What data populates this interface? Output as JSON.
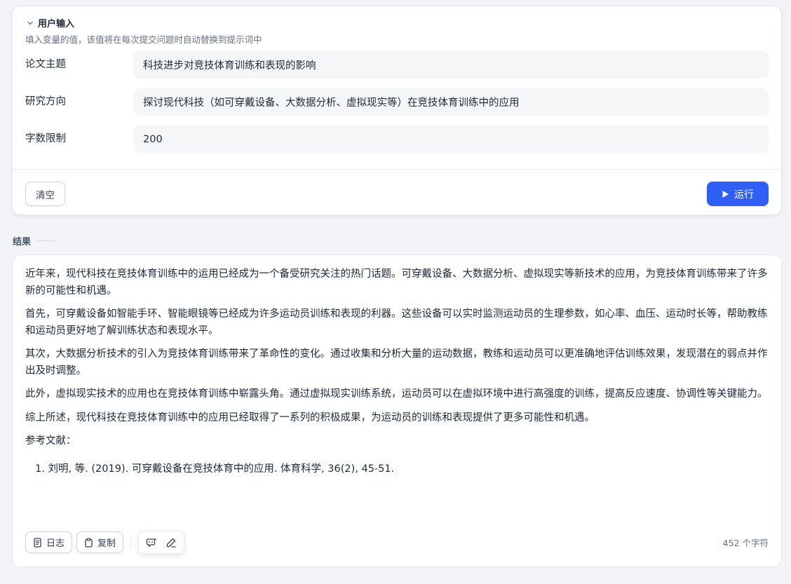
{
  "user_input": {
    "section_title": "用户输入",
    "description": "填入变量的值，该值将在每次提交问题时自动替换到提示词中",
    "fields": [
      {
        "label": "论文主题",
        "value": "科技进步对竞技体育训练和表现的影响"
      },
      {
        "label": "研究方向",
        "value": "探讨现代科技（如可穿戴设备、大数据分析、虚拟现实等）在竞技体育训练中的应用"
      },
      {
        "label": "字数限制",
        "value": "200"
      }
    ],
    "clear_label": "清空",
    "run_label": "运行"
  },
  "result": {
    "title": "结果",
    "paragraphs": [
      "近年来，现代科技在竞技体育训练中的运用已经成为一个备受研究关注的热门话题。可穿戴设备、大数据分析、虚拟现实等新技术的应用，为竞技体育训练带来了许多新的可能性和机遇。",
      "首先，可穿戴设备如智能手环、智能眼镜等已经成为许多运动员训练和表现的利器。这些设备可以实时监测运动员的生理参数，如心率、血压、运动时长等，帮助教练和运动员更好地了解训练状态和表现水平。",
      "其次，大数据分析技术的引入为竞技体育训练带来了革命性的变化。通过收集和分析大量的运动数据，教练和运动员可以更准确地评估训练效果，发现潜在的弱点并作出及时调整。",
      "此外，虚拟现实技术的应用也在竞技体育训练中崭露头角。通过虚拟现实训练系统，运动员可以在虚拟环境中进行高强度的训练，提高反应速度、协调性等关键能力。",
      "综上所述，现代科技在竞技体育训练中的应用已经取得了一系列的积极成果，为运动员的训练和表现提供了更多可能性和机遇。",
      "参考文献："
    ],
    "references": [
      "刘明, 等. (2019). 可穿戴设备在竞技体育中的应用. 体育科学, 36(2), 45-51."
    ],
    "log_label": "日志",
    "copy_label": "复制",
    "char_count": "452 个字符"
  },
  "colors": {
    "accent": "#2f5ff5",
    "background": "#f2f4f7"
  }
}
